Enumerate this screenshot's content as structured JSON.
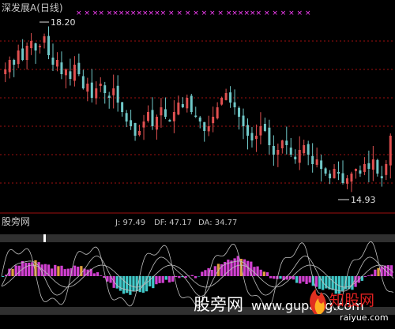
{
  "main_chart": {
    "title": "深发展A(日线)",
    "high_label": "18.20",
    "low_label": "14.93",
    "markers": "× × ×× ×××××××××× × × × × × × × ×××××× × × × × × ×"
  },
  "indicator": {
    "title": "股旁网",
    "j_label": "J: 97.49",
    "df_label": "DF: 47.17",
    "da_label": "DA: 34.77"
  },
  "watermark": {
    "site_cn": "股旁网",
    "site_url": "www.gupang.com",
    "logo_text": "知股网",
    "logo_url": "raiyue.com"
  },
  "colors": {
    "background": "#000000",
    "up": "#e05050",
    "down": "#70c8c8",
    "grid": "#a01010",
    "marker": "#ff40ff",
    "title": "#c8c8c8",
    "label": "#e0e0e0",
    "indicator_label": "#c0c0c0",
    "bar_magenta": "#d040d0",
    "bar_orange": "#e0a040",
    "bar_cyan": "#40c8c8",
    "band": "#303030",
    "line": "#c0c0c0"
  },
  "chart_data": [
    {
      "type": "candlestick",
      "title": "深发展A(日线)",
      "ylim": [
        14.5,
        18.5
      ],
      "annotations": [
        {
          "text": "18.20",
          "value": 18.2
        },
        {
          "text": "14.93",
          "value": 14.93
        }
      ],
      "close_approx": [
        17.4,
        17.6,
        17.5,
        17.8,
        17.6,
        17.9,
        18.0,
        17.8,
        17.9,
        18.1,
        17.7,
        17.5,
        17.6,
        17.3,
        17.4,
        17.2,
        17.5,
        17.3,
        17.0,
        17.1,
        16.8,
        17.0,
        17.1,
        16.9,
        16.8,
        17.0,
        16.7,
        16.5,
        16.3,
        16.2,
        16.0,
        16.1,
        16.3,
        16.5,
        16.2,
        16.4,
        16.6,
        16.4,
        16.3,
        16.5,
        16.7,
        16.6,
        16.8,
        16.5,
        16.4,
        16.3,
        16.1,
        16.2,
        16.4,
        16.6,
        16.8,
        16.9,
        16.7,
        16.6,
        16.4,
        16.2,
        16.0,
        15.9,
        16.0,
        16.2,
        16.1,
        15.8,
        15.6,
        15.7,
        15.9,
        15.8,
        15.6,
        15.5,
        15.7,
        15.8,
        15.6,
        15.4,
        15.5,
        15.3,
        15.2,
        15.1,
        15.3,
        15.2,
        15.0,
        15.1,
        15.2,
        15.3,
        15.2,
        15.4,
        15.3,
        15.5,
        15.2,
        15.1,
        15.4,
        16.0
      ]
    },
    {
      "type": "bar+line",
      "title": "股旁网",
      "series": [
        {
          "name": "J",
          "last": 97.49
        },
        {
          "name": "DF",
          "last": 47.17
        },
        {
          "name": "DA",
          "last": 34.77
        }
      ]
    }
  ]
}
